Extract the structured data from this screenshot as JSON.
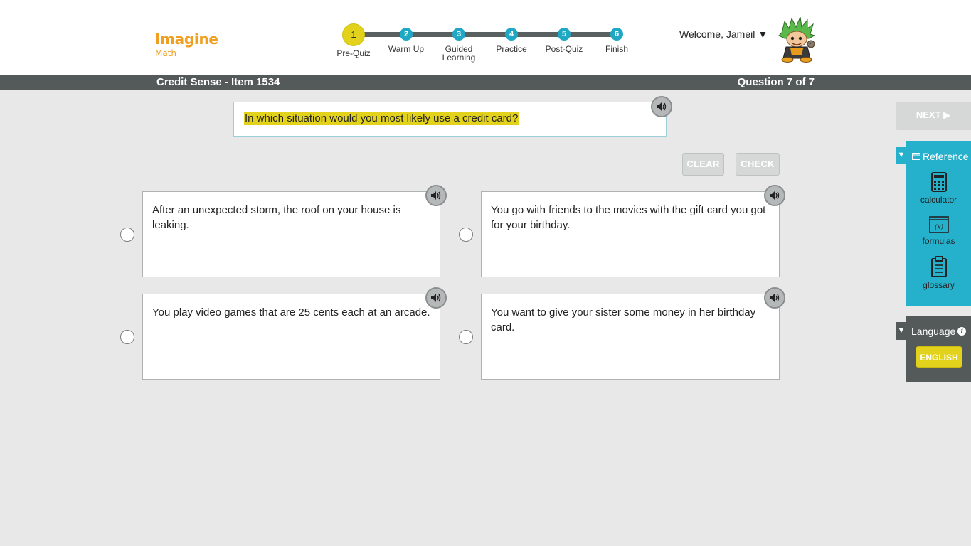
{
  "app": {
    "logo_main": "Imagine",
    "logo_sub": "Math"
  },
  "progress": {
    "steps": [
      {
        "num": "1",
        "label": "Pre-Quiz",
        "current": true
      },
      {
        "num": "2",
        "label": "Warm Up",
        "current": false
      },
      {
        "num": "3",
        "label": "Guided Learning",
        "current": false
      },
      {
        "num": "4",
        "label": "Practice",
        "current": false
      },
      {
        "num": "5",
        "label": "Post-Quiz",
        "current": false
      },
      {
        "num": "6",
        "label": "Finish",
        "current": false
      }
    ]
  },
  "user": {
    "welcome": "Welcome, Jameil",
    "caret": "▼"
  },
  "titlebar": {
    "title": "Credit Sense - Item 1534",
    "question_number": "Question 7 of 7"
  },
  "question": {
    "text": "In which situation would you most likely use a credit card?"
  },
  "buttons": {
    "clear": "CLEAR",
    "check": "CHECK",
    "next": "NEXT ▶"
  },
  "answers": [
    {
      "text": "After an unexpected storm, the roof on your house is leaking."
    },
    {
      "text": "You go with friends to the movies with the gift card you got for your birthday."
    },
    {
      "text": "You play video games that are 25 cents each at an arcade."
    },
    {
      "text": "You want to give your sister some money in her birthday card."
    }
  ],
  "reference": {
    "toggle": "▼",
    "title": "Reference",
    "items": [
      {
        "label": "calculator",
        "icon": "calculator-icon"
      },
      {
        "label": "formulas",
        "icon": "formulas-icon"
      },
      {
        "label": "glossary",
        "icon": "glossary-icon"
      }
    ]
  },
  "language": {
    "toggle": "▼",
    "title": "Language",
    "info": "i",
    "selected": "ENGLISH"
  },
  "colors": {
    "accent_teal": "#25b0cc",
    "highlight_yellow": "#e3d21c",
    "logo_orange": "#f0a020",
    "bar_gray": "#545a5a"
  }
}
